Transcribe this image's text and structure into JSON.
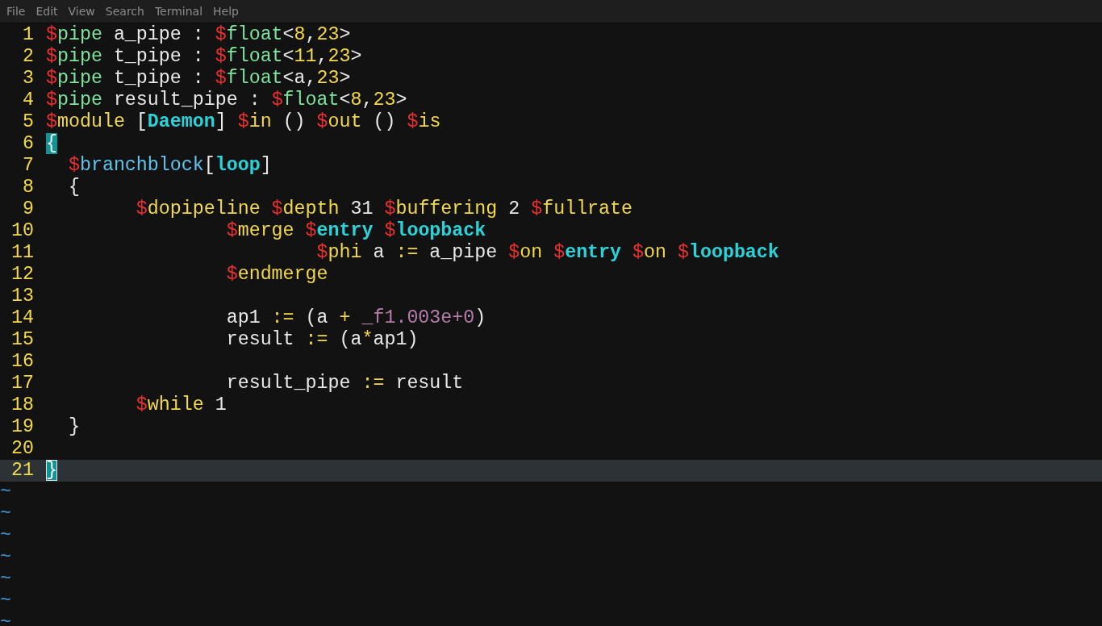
{
  "menu_bar": {
    "items": [
      "File",
      "Edit",
      "View",
      "Search",
      "Terminal",
      "Help"
    ]
  },
  "editor": {
    "lines": [
      {
        "number": "1",
        "current": false,
        "tokens": [
          {
            "text": "$",
            "kind": "sigil"
          },
          {
            "text": "pipe",
            "kind": "keyword"
          },
          {
            "text": " a_pipe : ",
            "kind": "text"
          },
          {
            "text": "$",
            "kind": "sigil"
          },
          {
            "text": "float",
            "kind": "keyword"
          },
          {
            "text": "<",
            "kind": "text"
          },
          {
            "text": "8",
            "kind": "number"
          },
          {
            "text": ",",
            "kind": "text"
          },
          {
            "text": "23",
            "kind": "number"
          },
          {
            "text": ">",
            "kind": "text"
          }
        ]
      },
      {
        "number": "2",
        "current": false,
        "tokens": [
          {
            "text": "$",
            "kind": "sigil"
          },
          {
            "text": "pipe",
            "kind": "keyword"
          },
          {
            "text": " t_pipe : ",
            "kind": "text"
          },
          {
            "text": "$",
            "kind": "sigil"
          },
          {
            "text": "float",
            "kind": "keyword"
          },
          {
            "text": "<",
            "kind": "text"
          },
          {
            "text": "11",
            "kind": "number"
          },
          {
            "text": ",",
            "kind": "text"
          },
          {
            "text": "23",
            "kind": "number"
          },
          {
            "text": ">",
            "kind": "text"
          }
        ]
      },
      {
        "number": "3",
        "current": false,
        "tokens": [
          {
            "text": "$",
            "kind": "sigil"
          },
          {
            "text": "pipe",
            "kind": "keyword"
          },
          {
            "text": " t_pipe : ",
            "kind": "text"
          },
          {
            "text": "$",
            "kind": "sigil"
          },
          {
            "text": "float",
            "kind": "keyword"
          },
          {
            "text": "<a,",
            "kind": "text"
          },
          {
            "text": "23",
            "kind": "number"
          },
          {
            "text": ">",
            "kind": "text"
          }
        ]
      },
      {
        "number": "4",
        "current": false,
        "tokens": [
          {
            "text": "$",
            "kind": "sigil"
          },
          {
            "text": "pipe",
            "kind": "keyword"
          },
          {
            "text": " result_pipe : ",
            "kind": "text"
          },
          {
            "text": "$",
            "kind": "sigil"
          },
          {
            "text": "float",
            "kind": "keyword"
          },
          {
            "text": "<",
            "kind": "text"
          },
          {
            "text": "8",
            "kind": "number"
          },
          {
            "text": ",",
            "kind": "text"
          },
          {
            "text": "23",
            "kind": "number"
          },
          {
            "text": ">",
            "kind": "text"
          }
        ]
      },
      {
        "number": "5",
        "current": false,
        "tokens": [
          {
            "text": "$",
            "kind": "sigil"
          },
          {
            "text": "module",
            "kind": "statement"
          },
          {
            "text": " [",
            "kind": "text"
          },
          {
            "text": "Daemon",
            "kind": "label"
          },
          {
            "text": "] ",
            "kind": "text"
          },
          {
            "text": "$",
            "kind": "sigil"
          },
          {
            "text": "in",
            "kind": "statement"
          },
          {
            "text": " () ",
            "kind": "text"
          },
          {
            "text": "$",
            "kind": "sigil"
          },
          {
            "text": "out",
            "kind": "statement"
          },
          {
            "text": " () ",
            "kind": "text"
          },
          {
            "text": "$",
            "kind": "sigil"
          },
          {
            "text": "is",
            "kind": "statement"
          }
        ]
      },
      {
        "number": "6",
        "current": false,
        "tokens": [
          {
            "text": "{",
            "kind": "match"
          }
        ]
      },
      {
        "number": "7",
        "current": false,
        "tokens": [
          {
            "text": "  $",
            "kind": "sigil"
          },
          {
            "text": "branchblock",
            "kind": "function"
          },
          {
            "text": "[",
            "kind": "text"
          },
          {
            "text": "loop",
            "kind": "label"
          },
          {
            "text": "]",
            "kind": "text"
          }
        ]
      },
      {
        "number": "8",
        "current": false,
        "tokens": [
          {
            "text": "  {",
            "kind": "text"
          }
        ]
      },
      {
        "number": "9",
        "current": false,
        "tokens": [
          {
            "text": "        $",
            "kind": "sigil"
          },
          {
            "text": "dopipeline",
            "kind": "statement"
          },
          {
            "text": " $",
            "kind": "sigil"
          },
          {
            "text": "depth",
            "kind": "statement"
          },
          {
            "text": " 31 ",
            "kind": "text"
          },
          {
            "text": "$",
            "kind": "sigil"
          },
          {
            "text": "buffering",
            "kind": "statement"
          },
          {
            "text": " 2 ",
            "kind": "text"
          },
          {
            "text": "$",
            "kind": "sigil"
          },
          {
            "text": "fullrate",
            "kind": "statement"
          }
        ]
      },
      {
        "number": "10",
        "current": false,
        "tokens": [
          {
            "text": "                $",
            "kind": "sigil"
          },
          {
            "text": "merge",
            "kind": "statement"
          },
          {
            "text": " $",
            "kind": "sigil"
          },
          {
            "text": "entry",
            "kind": "label"
          },
          {
            "text": " $",
            "kind": "sigil"
          },
          {
            "text": "loopback",
            "kind": "label"
          }
        ]
      },
      {
        "number": "11",
        "current": false,
        "tokens": [
          {
            "text": "                        $",
            "kind": "sigil"
          },
          {
            "text": "phi",
            "kind": "statement"
          },
          {
            "text": " a ",
            "kind": "text"
          },
          {
            "text": ":=",
            "kind": "operator"
          },
          {
            "text": " a_pipe ",
            "kind": "text"
          },
          {
            "text": "$",
            "kind": "sigil"
          },
          {
            "text": "on",
            "kind": "statement"
          },
          {
            "text": " $",
            "kind": "sigil"
          },
          {
            "text": "entry",
            "kind": "label"
          },
          {
            "text": " $",
            "kind": "sigil"
          },
          {
            "text": "on",
            "kind": "statement"
          },
          {
            "text": " $",
            "kind": "sigil"
          },
          {
            "text": "loopback",
            "kind": "label"
          }
        ]
      },
      {
        "number": "12",
        "current": false,
        "tokens": [
          {
            "text": "                $",
            "kind": "sigil"
          },
          {
            "text": "endmerge",
            "kind": "statement"
          }
        ]
      },
      {
        "number": "13",
        "current": false
      },
      {
        "number": "14",
        "current": false,
        "tokens": [
          {
            "text": "                ap1 ",
            "kind": "text"
          },
          {
            "text": ":=",
            "kind": "operator"
          },
          {
            "text": " (a ",
            "kind": "text"
          },
          {
            "text": "+",
            "kind": "operator"
          },
          {
            "text": " _f1.003e+0",
            "kind": "constant"
          },
          {
            "text": ")",
            "kind": "text"
          }
        ]
      },
      {
        "number": "15",
        "current": false,
        "tokens": [
          {
            "text": "                result ",
            "kind": "text"
          },
          {
            "text": ":=",
            "kind": "operator"
          },
          {
            "text": " (a",
            "kind": "text"
          },
          {
            "text": "*",
            "kind": "operator"
          },
          {
            "text": "ap1)",
            "kind": "text"
          }
        ]
      },
      {
        "number": "16",
        "current": false
      },
      {
        "number": "17",
        "current": false,
        "tokens": [
          {
            "text": "                result_pipe ",
            "kind": "text"
          },
          {
            "text": ":=",
            "kind": "operator"
          },
          {
            "text": " result",
            "kind": "text"
          }
        ]
      },
      {
        "number": "18",
        "current": false,
        "tokens": [
          {
            "text": "        $",
            "kind": "sigil"
          },
          {
            "text": "while",
            "kind": "statement"
          },
          {
            "text": " 1",
            "kind": "text"
          }
        ]
      },
      {
        "number": "19",
        "current": false,
        "tokens": [
          {
            "text": "  }",
            "kind": "text"
          }
        ]
      },
      {
        "number": "20",
        "current": false
      },
      {
        "number": "21",
        "current": true,
        "tokens": [
          {
            "text": "}",
            "kind": "cursor"
          }
        ]
      }
    ],
    "tildes": [
      "~",
      "~",
      "~",
      "~",
      "~",
      "~",
      "~"
    ]
  }
}
